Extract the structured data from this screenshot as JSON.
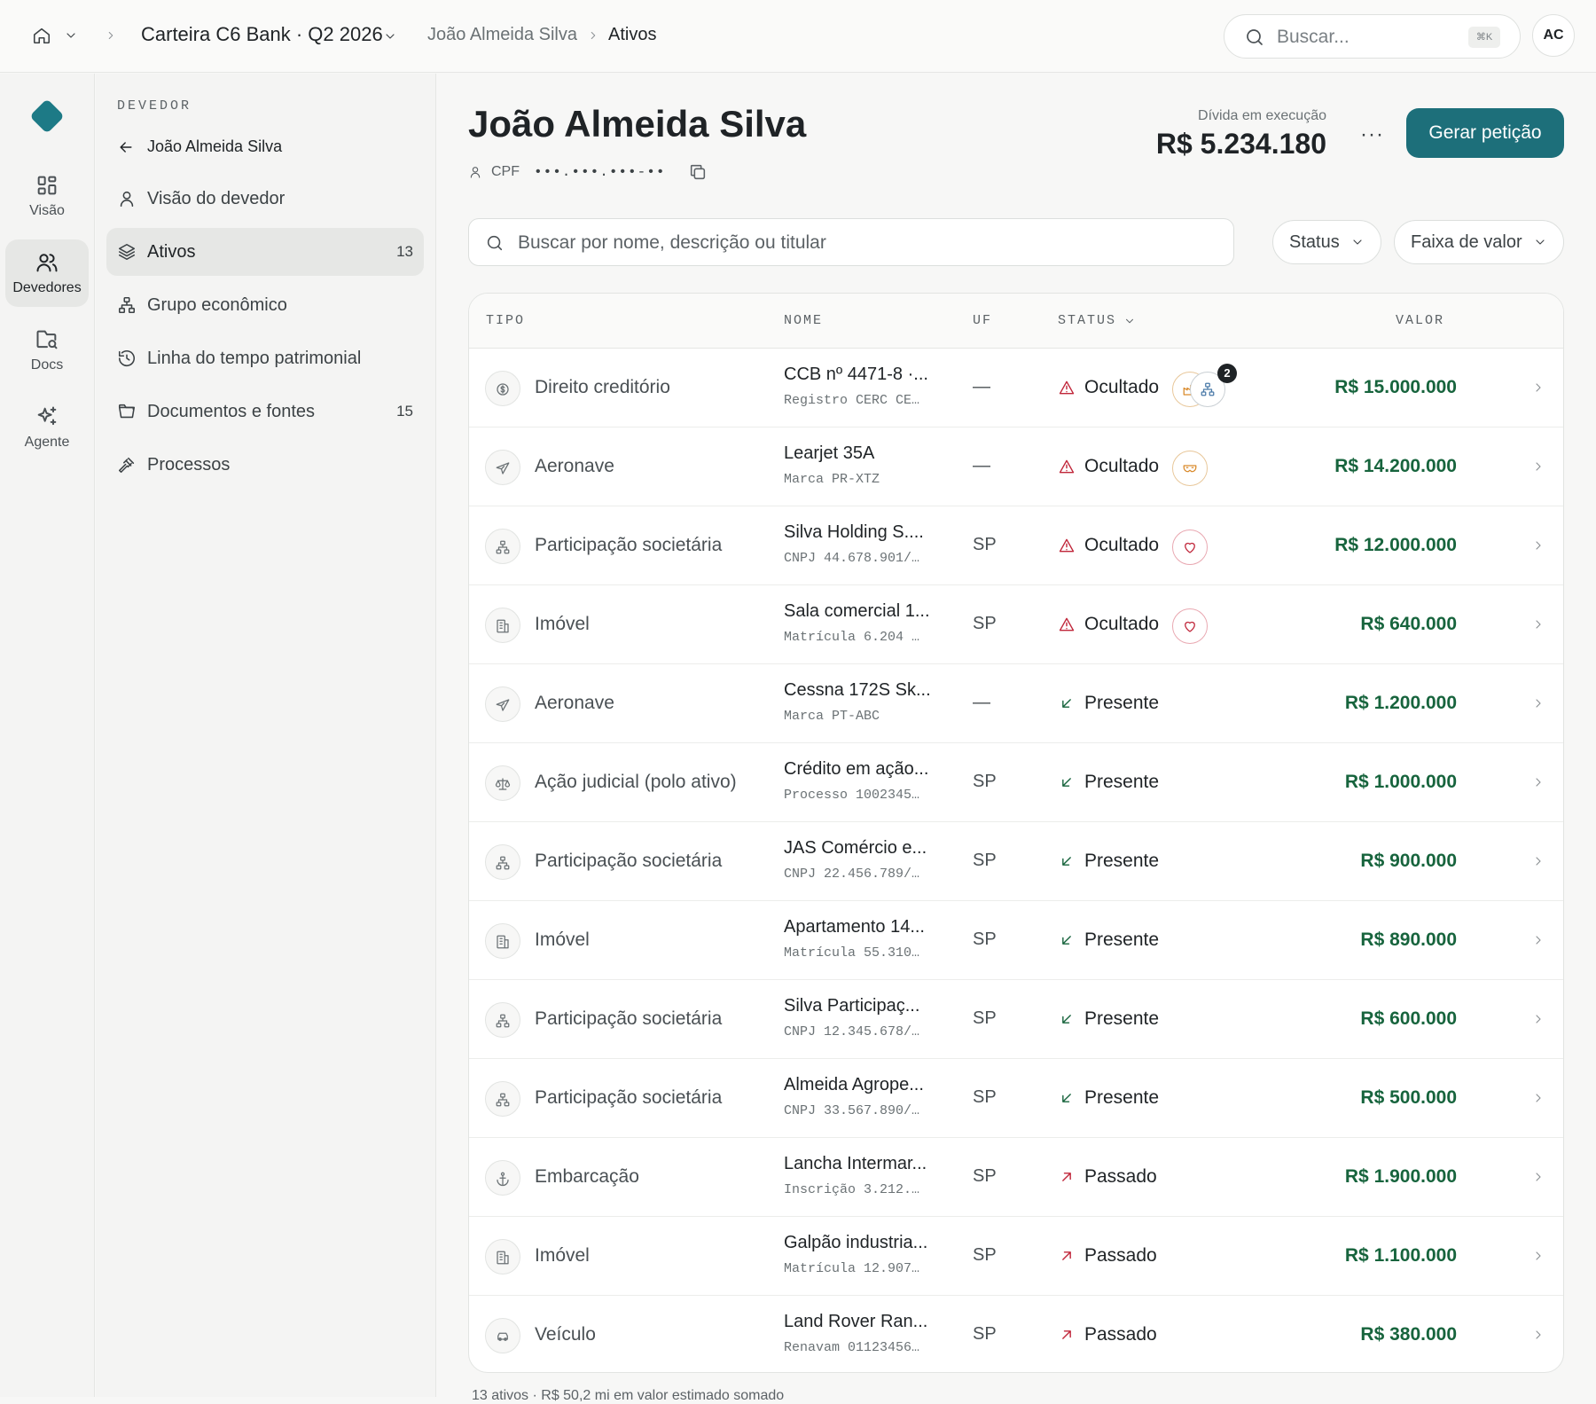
{
  "topbar": {
    "portfolio": "Carteira C6 Bank · Q2 2026",
    "breadcrumb_debtor": "João Almeida Silva",
    "breadcrumb_current": "Ativos",
    "search_placeholder": "Buscar...",
    "search_shortcut": "⌘K",
    "avatar_initials": "AC"
  },
  "rail": {
    "items": [
      {
        "label": "Visão",
        "icon": "grid-icon"
      },
      {
        "label": "Devedores",
        "icon": "users-icon"
      },
      {
        "label": "Docs",
        "icon": "folder-search-icon"
      },
      {
        "label": "Agente",
        "icon": "sparkles-icon"
      }
    ]
  },
  "sidebar": {
    "caption": "DEVEDOR",
    "back_label": "João Almeida Silva",
    "items": [
      {
        "label": "Visão do devedor",
        "count": ""
      },
      {
        "label": "Ativos",
        "count": "13"
      },
      {
        "label": "Grupo econômico",
        "count": ""
      },
      {
        "label": "Linha do tempo patrimonial",
        "count": ""
      },
      {
        "label": "Documentos e fontes",
        "count": "15"
      },
      {
        "label": "Processos",
        "count": ""
      }
    ]
  },
  "header": {
    "name": "João Almeida Silva",
    "cpf_label": "CPF",
    "cpf_value": "•••.•••.•••-••",
    "debt_label": "Dívida em execução",
    "debt_value": "R$ 5.234.180",
    "more_label": "···",
    "primary_button": "Gerar petição"
  },
  "filters": {
    "search_placeholder": "Buscar por nome, descrição ou titular",
    "status_label": "Status",
    "range_label": "Faixa de valor"
  },
  "table": {
    "headers": {
      "tipo": "TIPO",
      "nome": "NOME",
      "uf": "UF",
      "status": "STATUS",
      "valor": "VALOR"
    },
    "rows": [
      {
        "tipo": "Direito creditório",
        "nome": "CCB nº 4471-8 ·...",
        "sub": "Registro CERC CE…",
        "uf": "—",
        "status": "Ocultado",
        "valor": "R$ 15.000.000"
      },
      {
        "tipo": "Aeronave",
        "nome": "Learjet 35A",
        "sub": "Marca PR-XTZ",
        "uf": "—",
        "status": "Ocultado",
        "valor": "R$ 14.200.000"
      },
      {
        "tipo": "Participação societária",
        "nome": "Silva Holding S....",
        "sub": "CNPJ 44.678.901/…",
        "uf": "SP",
        "status": "Ocultado",
        "valor": "R$ 12.000.000"
      },
      {
        "tipo": "Imóvel",
        "nome": "Sala comercial 1...",
        "sub": "Matrícula 6.204 …",
        "uf": "SP",
        "status": "Ocultado",
        "valor": "R$ 640.000"
      },
      {
        "tipo": "Aeronave",
        "nome": "Cessna 172S Sk...",
        "sub": "Marca PT-ABC",
        "uf": "—",
        "status": "Presente",
        "valor": "R$ 1.200.000"
      },
      {
        "tipo": "Ação judicial (polo ativo)",
        "nome": "Crédito em ação...",
        "sub": "Processo 1002345…",
        "uf": "SP",
        "status": "Presente",
        "valor": "R$ 1.000.000"
      },
      {
        "tipo": "Participação societária",
        "nome": "JAS Comércio e...",
        "sub": "CNPJ 22.456.789/…",
        "uf": "SP",
        "status": "Presente",
        "valor": "R$ 900.000"
      },
      {
        "tipo": "Imóvel",
        "nome": "Apartamento 14...",
        "sub": "Matrícula 55.310…",
        "uf": "SP",
        "status": "Presente",
        "valor": "R$ 890.000"
      },
      {
        "tipo": "Participação societária",
        "nome": "Silva Participaç...",
        "sub": "CNPJ 12.345.678/…",
        "uf": "SP",
        "status": "Presente",
        "valor": "R$ 600.000"
      },
      {
        "tipo": "Participação societária",
        "nome": "Almeida Agrope...",
        "sub": "CNPJ 33.567.890/…",
        "uf": "SP",
        "status": "Presente",
        "valor": "R$ 500.000"
      },
      {
        "tipo": "Embarcação",
        "nome": "Lancha Intermar...",
        "sub": "Inscrição 3.212.…",
        "uf": "SP",
        "status": "Passado",
        "valor": "R$ 1.900.000"
      },
      {
        "tipo": "Imóvel",
        "nome": "Galpão industria...",
        "sub": "Matrícula 12.907…",
        "uf": "SP",
        "status": "Passado",
        "valor": "R$ 1.100.000"
      },
      {
        "tipo": "Veículo",
        "nome": "Land Rover Ran...",
        "sub": "Renavam 01123456…",
        "uf": "SP",
        "status": "Passado",
        "valor": "R$ 380.000"
      }
    ],
    "badge_count": "2"
  },
  "footer": {
    "summary": "13 ativos · R$ 50,2 mi em valor estimado somado"
  },
  "colors": {
    "accent": "#1d6f7a",
    "value_green": "#17643d",
    "danger": "#c0263a",
    "badge_orange": "#d98a2b"
  }
}
